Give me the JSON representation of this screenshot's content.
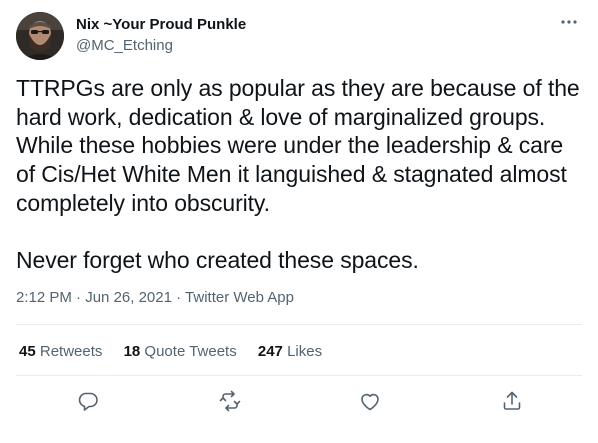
{
  "user": {
    "display_name": "Nix ~Your Proud Punkle",
    "handle": "@MC_Etching"
  },
  "tweet": {
    "text": "TTRPGs are only as popular as they are because of the hard work, dedication & love of marginalized groups. While these hobbies were under the leadership & care of Cis/Het White Men it languished & stagnated almost completely into obscurity.\n\nNever forget who created these spaces.",
    "time": "2:12 PM",
    "date": "Jun 26, 2021",
    "separator": " · ",
    "app": "Twitter Web App"
  },
  "stats": {
    "retweets": {
      "count": "45",
      "label": "Retweets"
    },
    "quote_tweets": {
      "count": "18",
      "label": "Quote Tweets"
    },
    "likes": {
      "count": "247",
      "label": "Likes"
    }
  },
  "actions": [
    "reply-icon",
    "retweet-icon",
    "like-icon",
    "share-icon"
  ],
  "colors": {
    "text": "#0f1419",
    "secondary": "#536471",
    "divider": "#e6ecf0"
  }
}
